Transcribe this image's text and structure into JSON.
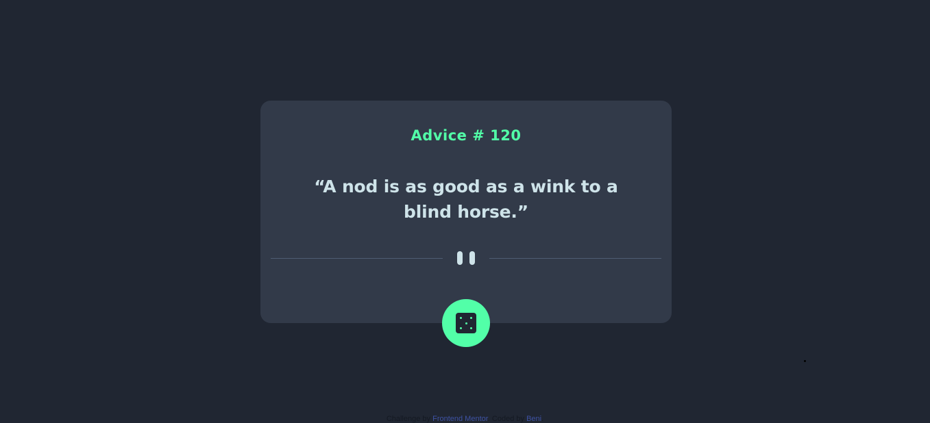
{
  "card": {
    "advice_heading": "Advice # 120",
    "quote": "“A nod is as good as a wink to a blind horse.”"
  },
  "icons": {
    "divider": "pause-icon",
    "generate_button": "dice-icon"
  },
  "attribution": {
    "prefix": "Challenge by",
    "challenge_link": "Frontend Mentor",
    "separator": ". Coded by",
    "author_link": "Beni",
    "suffix": "."
  },
  "colors": {
    "background": "#202632",
    "card": "#323a49",
    "accent": "#52ffa8",
    "text": "#cee3e9",
    "divider": "#4f5d74",
    "link": "#3e52a3"
  }
}
